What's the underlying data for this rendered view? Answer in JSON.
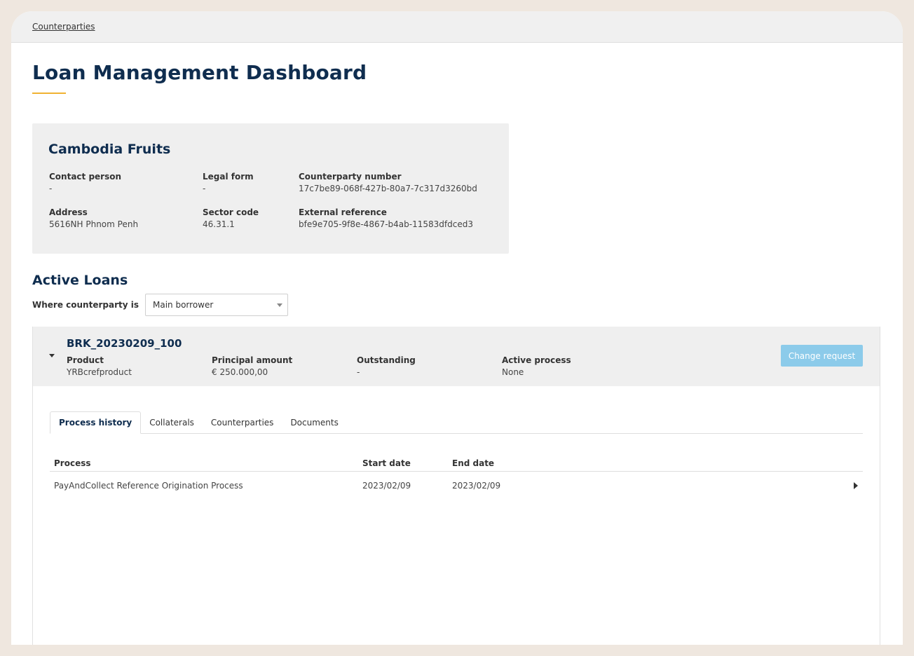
{
  "breadcrumb": {
    "label": "Counterparties"
  },
  "page": {
    "title": "Loan Management Dashboard"
  },
  "counterparty": {
    "name": "Cambodia Fruits",
    "contact_person": {
      "label": "Contact person",
      "value": "-"
    },
    "legal_form": {
      "label": "Legal form",
      "value": "-"
    },
    "counterparty_number": {
      "label": "Counterparty number",
      "value": "17c7be89-068f-427b-80a7-7c317d3260bd"
    },
    "address": {
      "label": "Address",
      "value": "5616NH Phnom Penh"
    },
    "sector_code": {
      "label": "Sector code",
      "value": "46.31.1"
    },
    "external_reference": {
      "label": "External reference",
      "value": "bfe9e705-9f8e-4867-b4ab-11583dfdced3"
    }
  },
  "active_loans": {
    "title": "Active Loans",
    "filter_label": "Where counterparty is",
    "filter_value": "Main borrower"
  },
  "loan": {
    "id": "BRK_20230209_100",
    "product": {
      "label": "Product",
      "value": "YRBcrefproduct"
    },
    "principal": {
      "label": "Principal amount",
      "value": "€ 250.000,00"
    },
    "outstanding": {
      "label": "Outstanding",
      "value": "-"
    },
    "active_process": {
      "label": "Active process",
      "value": "None"
    },
    "change_request_label": "Change request"
  },
  "tabs": [
    {
      "label": "Process history",
      "active": true
    },
    {
      "label": "Collaterals",
      "active": false
    },
    {
      "label": "Counterparties",
      "active": false
    },
    {
      "label": "Documents",
      "active": false
    }
  ],
  "process_table": {
    "headers": {
      "process": "Process",
      "start": "Start date",
      "end": "End date"
    },
    "rows": [
      {
        "process": "PayAndCollect Reference Origination Process",
        "start": "2023/02/09",
        "end": "2023/02/09"
      }
    ]
  },
  "colors": {
    "title": "#0f2d4f",
    "accent": "#f0b232",
    "button": "#8ccbea"
  }
}
